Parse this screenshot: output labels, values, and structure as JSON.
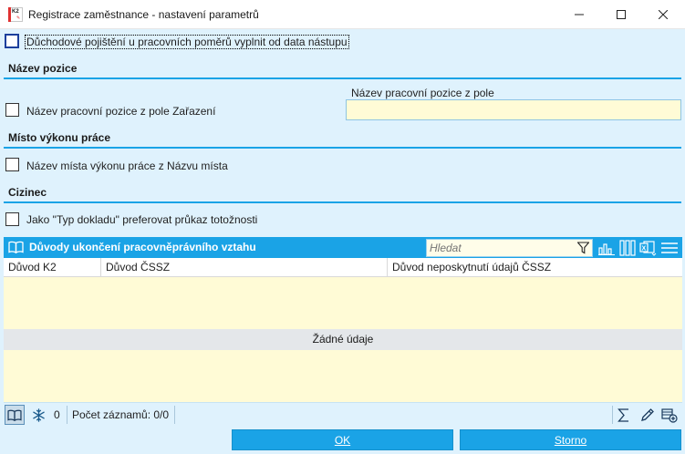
{
  "window": {
    "title": "Registrace zaměstnance - nastavení parametrů",
    "icon_label": "K2"
  },
  "options": {
    "pension_checkbox_label": "Důchodové pojištění u pracovních poměrů vyplnit od data nástupu"
  },
  "position_section": {
    "title": "Název pozice",
    "checkbox_label": "Název pracovní pozice z pole Zařazení",
    "field_label": "Název pracovní pozice z pole",
    "field_value": ""
  },
  "workplace_section": {
    "title": "Místo výkonu práce",
    "checkbox_label": "Název místa výkonu práce z Názvu místa"
  },
  "foreigner_section": {
    "title": "Cizinec",
    "checkbox_label": "Jako \"Typ dokladu\" preferovat průkaz totožnosti"
  },
  "grid": {
    "title": "Důvody ukončení pracovněprávního vztahu",
    "search_placeholder": "Hledat",
    "columns": [
      "Důvod K2",
      "Důvod ČSSZ",
      "Důvod neposkytnutí údajů ČSSZ"
    ],
    "empty_text": "Žádné údaje",
    "footer": {
      "frozen_count": "0",
      "record_count": "Počet záznamů: 0/0"
    }
  },
  "buttons": {
    "ok": "OK",
    "cancel": "Storno"
  },
  "colors": {
    "accent": "#1aa3e6",
    "background": "#dff2fd",
    "input_background": "#fffbd6"
  }
}
